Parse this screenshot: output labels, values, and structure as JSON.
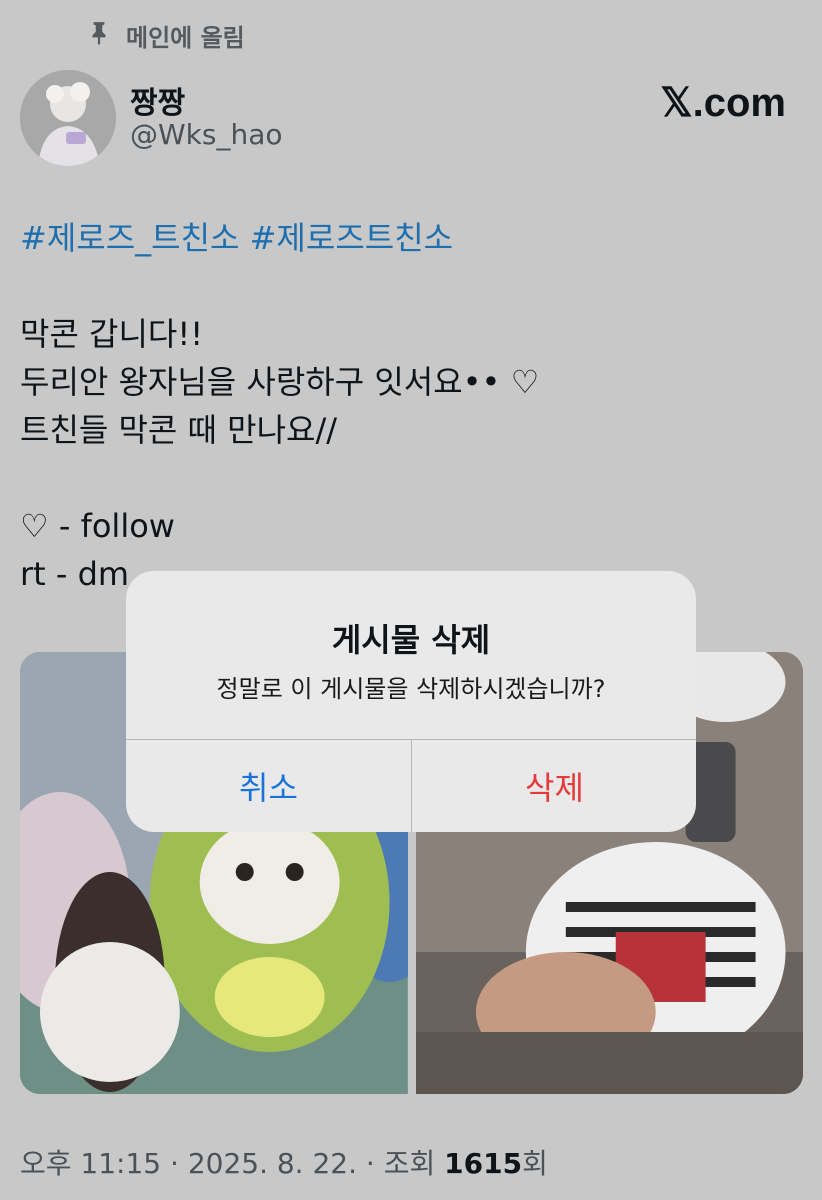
{
  "pinned_label": "메인에 올림",
  "user": {
    "display_name": "짱짱",
    "handle": "@Wks_hao"
  },
  "brand": "𝕏.com",
  "tweet": {
    "hashtags": "#제로즈_트친소 #제로즈트친소",
    "lines": [
      "막콘 갑니다!!",
      "두리안 왕자님을 사랑하구 잇서요•• ♡",
      "트친들 막콘 때 만나요//",
      "♡ - follow",
      "rt - dm"
    ]
  },
  "meta": {
    "time": "오후 11:15 · 2025. 8. 22. · 조회 ",
    "views": "1615",
    "views_suffix": "회"
  },
  "dialog": {
    "title": "게시물 삭제",
    "message": "정말로 이 게시물을 삭제하시겠습니까?",
    "cancel_label": "취소",
    "delete_label": "삭제"
  },
  "colors": {
    "hashtag": "#1d6fb0",
    "cancel": "#1a73d9",
    "delete": "#e5393b",
    "overlay": "#c8c8c8"
  }
}
